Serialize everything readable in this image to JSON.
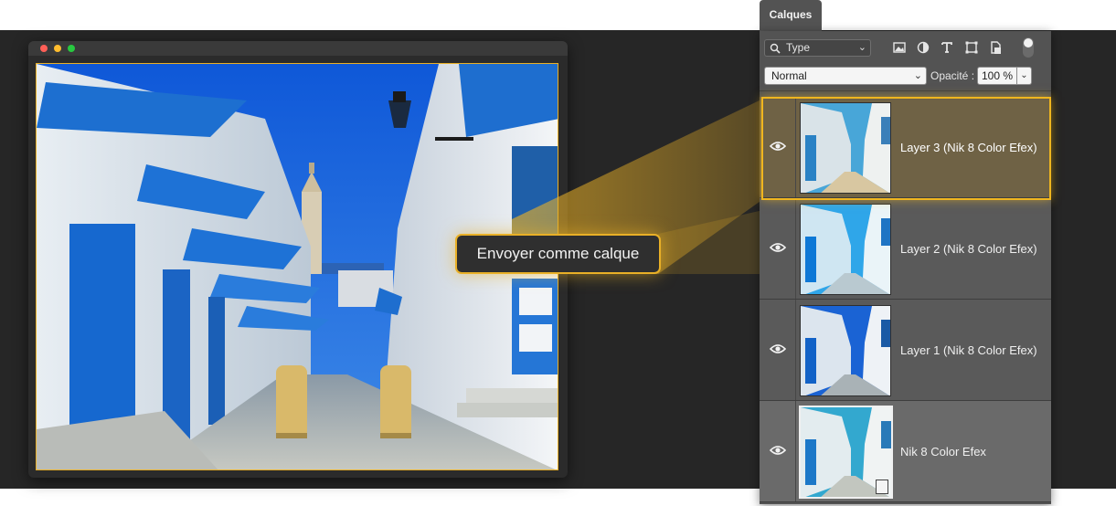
{
  "window": {
    "traffic_lights": [
      "#ff5f57",
      "#febc2e",
      "#28c840"
    ]
  },
  "tooltip": {
    "label": "Envoyer comme calque"
  },
  "panel": {
    "tab_label": "Calques",
    "filter": {
      "label": "Type",
      "icons": [
        "search-icon",
        "image-filter-icon",
        "adjustment-filter-icon",
        "type-filter-icon",
        "shape-filter-icon",
        "smart-object-filter-icon"
      ]
    },
    "blend_mode": "Normal",
    "opacity_label": "Opacité :",
    "opacity_value": "100 %",
    "layers": [
      {
        "name": "Layer 3 (Nik 8 Color Efex)",
        "visible": true,
        "selected": true,
        "tint": "warm"
      },
      {
        "name": "Layer 2 (Nik 8 Color Efex)",
        "visible": true,
        "selected": false,
        "tint": "cyan"
      },
      {
        "name": "Layer 1 (Nik 8 Color Efex)",
        "visible": true,
        "selected": false,
        "tint": "blue"
      },
      {
        "name": "Nik 8 Color Efex",
        "visible": true,
        "selected": false,
        "tint": "smart"
      }
    ]
  },
  "colors": {
    "accent": "#e9b027",
    "panel": "#535353",
    "backdrop": "#262626"
  }
}
